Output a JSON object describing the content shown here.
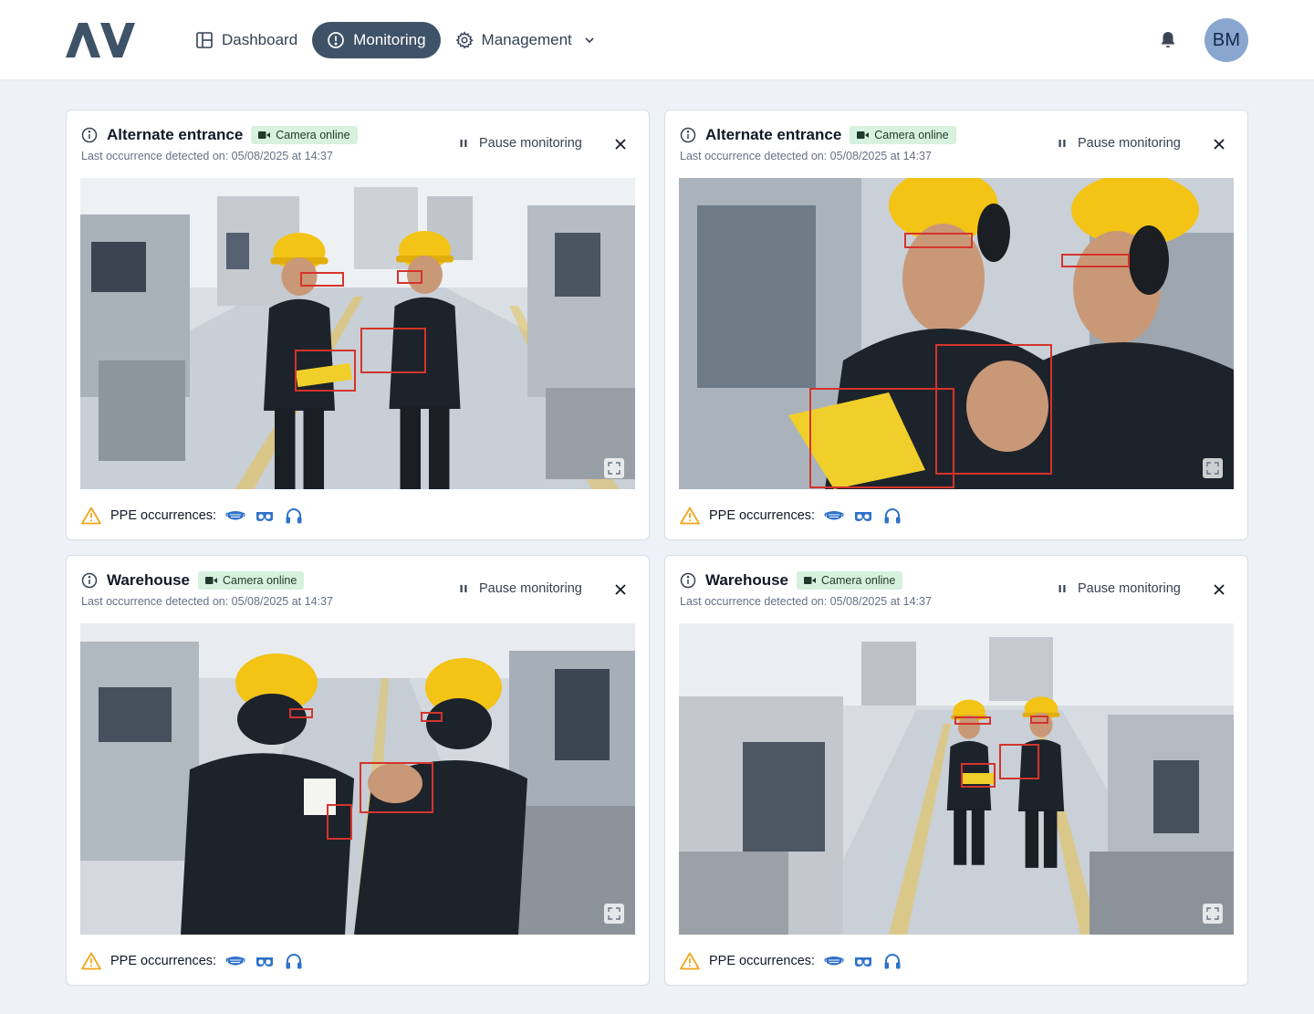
{
  "header": {
    "logo_text": "AV",
    "nav": [
      {
        "label": "Dashboard",
        "icon": "layout-icon",
        "active": false
      },
      {
        "label": "Monitoring",
        "icon": "alert-circle-icon",
        "active": true
      },
      {
        "label": "Management",
        "icon": "gear-icon",
        "active": false
      }
    ],
    "avatar_initials": "BM"
  },
  "labels": {
    "pause": "Pause monitoring",
    "ppe": "PPE occurrences:",
    "badge": "Camera online"
  },
  "cards": [
    {
      "title": "Alternate entrance",
      "status": "Camera online",
      "last_detected": "Last occurrence detected on: 05/08/2025 at 14:37",
      "ppe_icons": [
        "mask-icon",
        "goggles-icon",
        "headphones-icon"
      ]
    },
    {
      "title": "Alternate entrance",
      "status": "Camera online",
      "last_detected": "Last occurrence detected on: 05/08/2025 at 14:37",
      "ppe_icons": [
        "mask-icon",
        "goggles-icon",
        "headphones-icon"
      ]
    },
    {
      "title": "Warehouse",
      "status": "Camera online",
      "last_detected": "Last occurrence detected on: 05/08/2025 at 14:37",
      "ppe_icons": [
        "mask-icon",
        "goggles-icon",
        "headphones-icon"
      ]
    },
    {
      "title": "Warehouse",
      "status": "Camera online",
      "last_detected": "Last occurrence detected on: 05/08/2025 at 14:37",
      "ppe_icons": [
        "mask-icon",
        "goggles-icon",
        "headphones-icon"
      ]
    }
  ],
  "colors": {
    "accent_nav": "#3f5368",
    "badge_bg": "#d6f1dd",
    "detection_box": "#d4342c",
    "ppe_icon": "#2f72c9",
    "warning": "#f2a51b"
  }
}
